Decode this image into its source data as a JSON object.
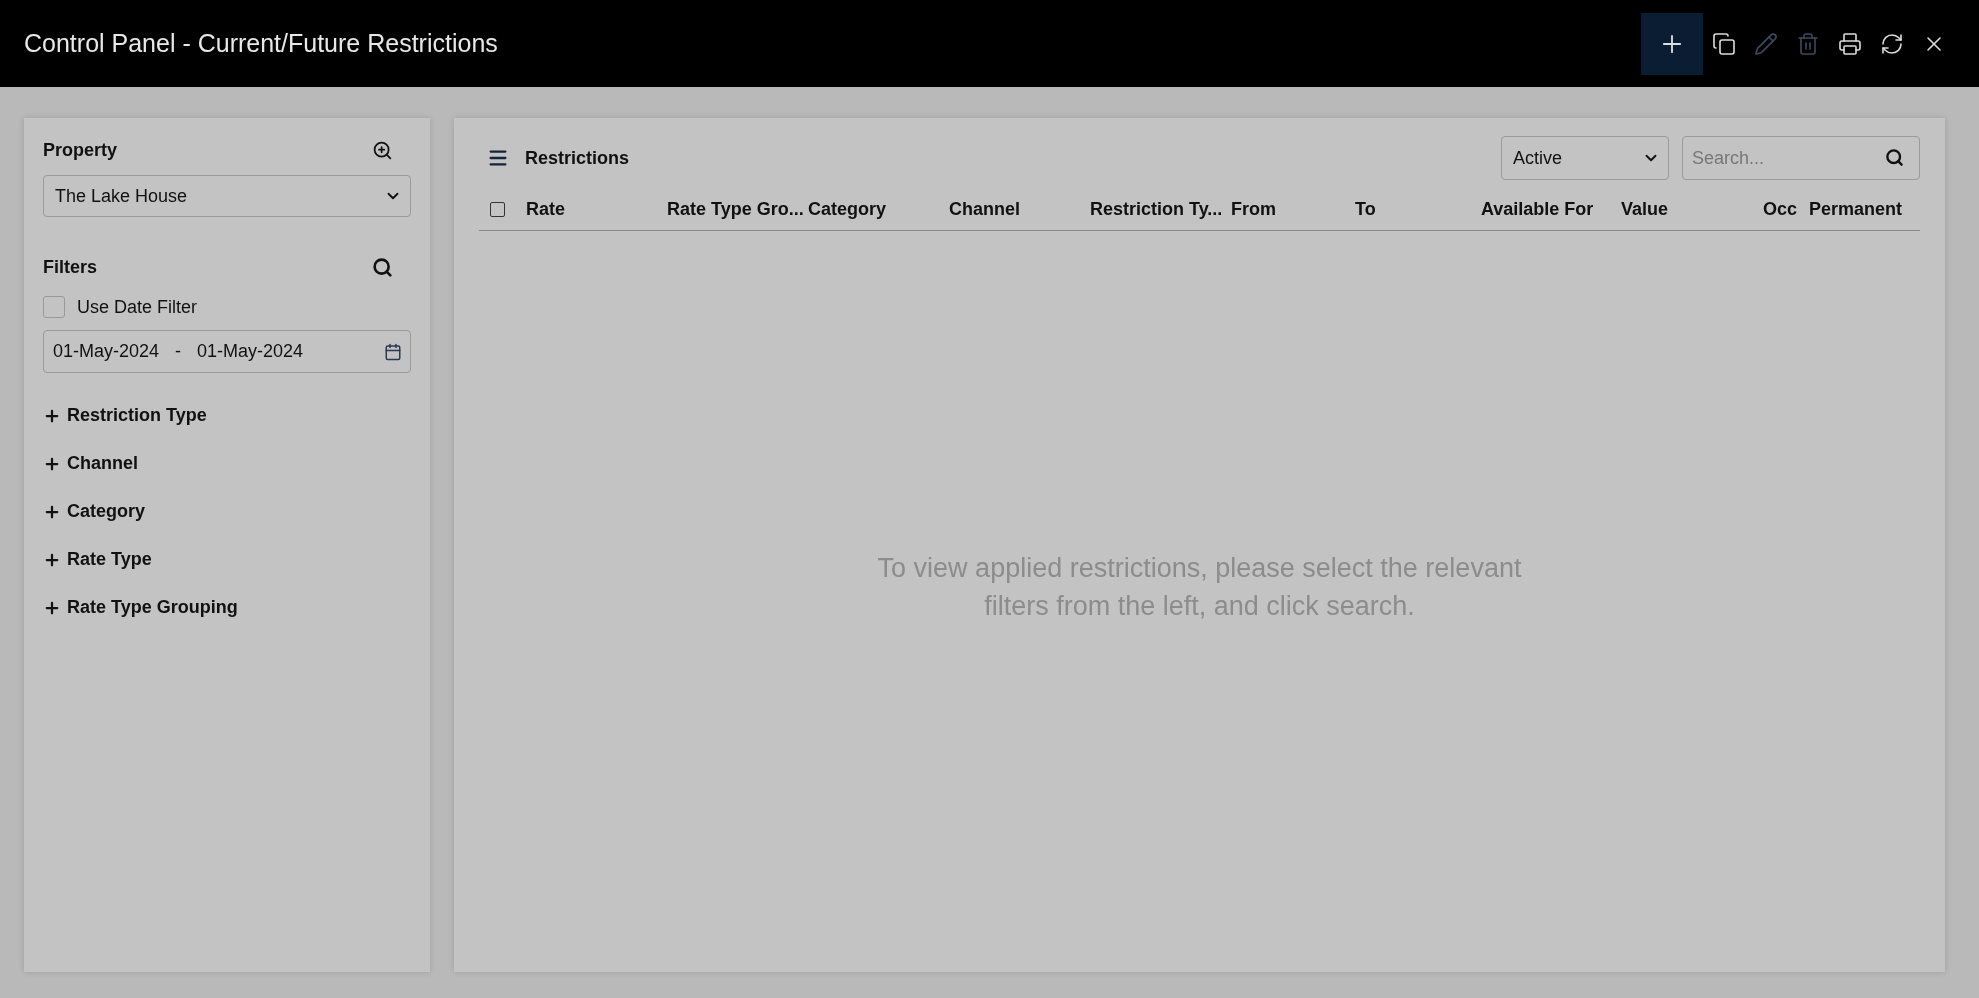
{
  "window": {
    "title": "Control Panel - Current/Future Restrictions"
  },
  "toolbar": [
    {
      "kind": "add",
      "disabled": false,
      "selected": true
    },
    {
      "kind": "copy",
      "disabled": false,
      "selected": false
    },
    {
      "kind": "edit",
      "disabled": true,
      "selected": false
    },
    {
      "kind": "delete",
      "disabled": true,
      "selected": false
    },
    {
      "kind": "print",
      "disabled": false,
      "selected": false
    },
    {
      "kind": "refresh",
      "disabled": false,
      "selected": false
    },
    {
      "kind": "close",
      "disabled": false,
      "selected": false
    }
  ],
  "sidebar": {
    "property_label": "Property",
    "property_value": "The Lake House",
    "filters_label": "Filters",
    "use_date_filter": {
      "label": "Use Date Filter",
      "checked": false
    },
    "date_from": "01-May-2024",
    "date_separator": "-",
    "date_to": "01-May-2024",
    "sections": [
      {
        "label": "Restriction Type",
        "expanded": false
      },
      {
        "label": "Channel",
        "expanded": false
      },
      {
        "label": "Category",
        "expanded": false
      },
      {
        "label": "Rate Type",
        "expanded": false
      },
      {
        "label": "Rate Type Grouping",
        "expanded": false
      }
    ]
  },
  "main": {
    "title": "Restrictions",
    "status_value": "Active",
    "search": {
      "placeholder": "Search..."
    },
    "table": {
      "select_all_checked": false,
      "columns": [
        "Rate",
        "Rate Type Gro...",
        "Category",
        "Channel",
        "Restriction Ty...",
        "From",
        "To",
        "Available For",
        "Value",
        "Occ",
        "Permanent"
      ]
    },
    "empty_message": "To view applied restrictions, please select the relevant filters from the left, and click search."
  }
}
